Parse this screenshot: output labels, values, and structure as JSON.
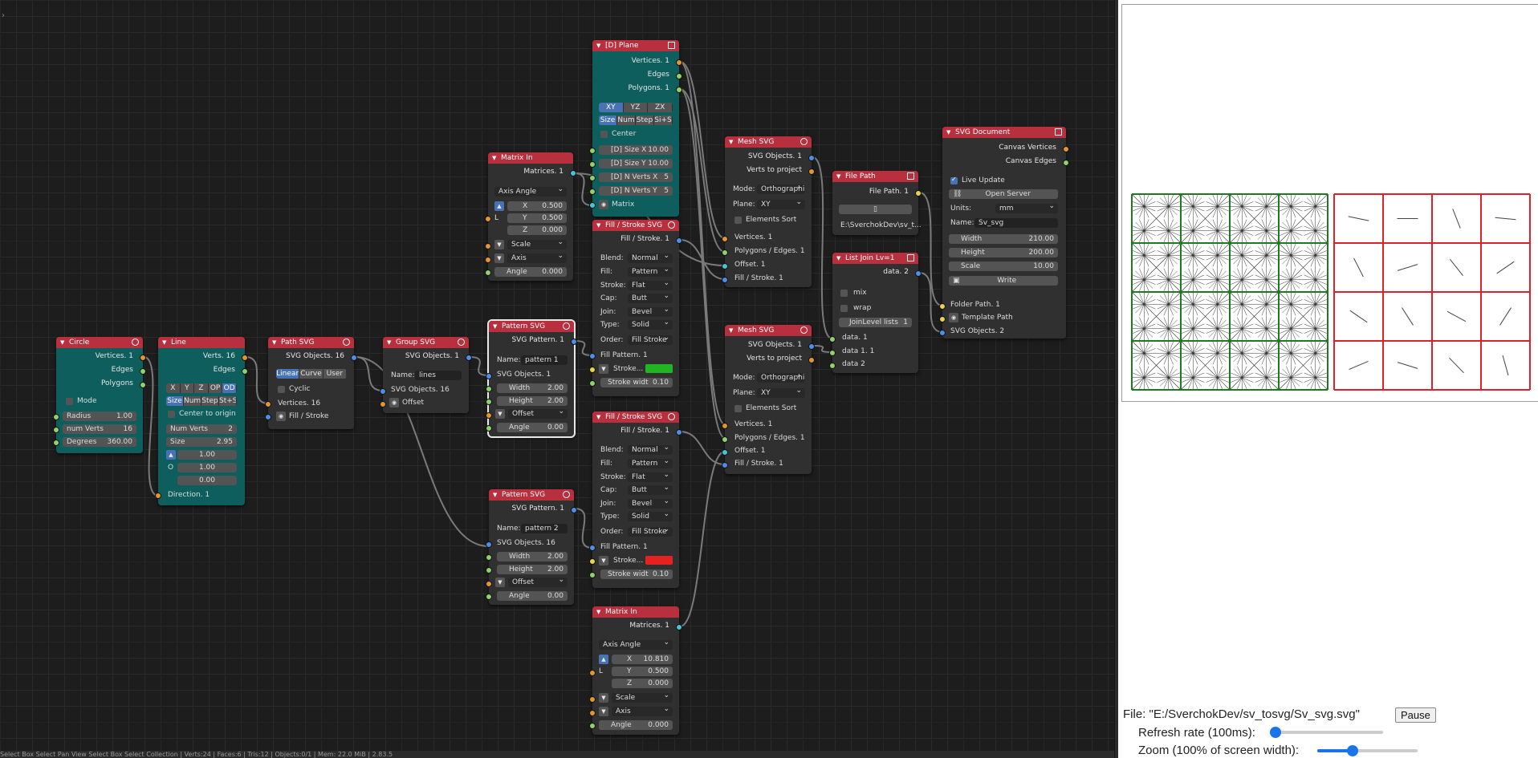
{
  "nodes": {
    "circle": {
      "title": "Circle",
      "outs": [
        "Vertices. 1",
        "Edges",
        "Polygons"
      ],
      "mode": "Mode",
      "radius_k": "Radius",
      "radius_v": "1.00",
      "numverts_k": "num Verts",
      "numverts_v": "16",
      "degrees_k": "Degrees",
      "degrees_v": "360.00"
    },
    "line": {
      "title": "Line",
      "outs": [
        "Verts. 16",
        "Edges"
      ],
      "seg": [
        "X",
        "Y",
        "Z",
        "OP",
        "OD"
      ],
      "seg2": [
        "Size",
        "Num",
        "Step",
        "St+S"
      ],
      "center": "Center to origin",
      "numverts_k": "Num Verts",
      "numverts_v": "2",
      "size_k": "Size",
      "size_v": "2.95",
      "v1": "1.00",
      "o_label": "O",
      "v2": "1.00",
      "v3": "0.00",
      "dir": "Direction. 1"
    },
    "pathsvg": {
      "title": "Path SVG",
      "out": "SVG Objects. 16",
      "seg": [
        "Linear",
        "Curve",
        "User"
      ],
      "cyclic": "Cyclic",
      "in1": "Vertices. 16",
      "in2": "Fill / Stroke"
    },
    "groupsvg": {
      "title": "Group SVG",
      "out": "SVG Objects. 1",
      "name_k": "Name:",
      "name_v": "lines",
      "in1": "SVG Objects. 16",
      "in2": "Offset"
    },
    "matrixin1": {
      "title": "Matrix In",
      "out": "Matrices. 1",
      "mode": "Axis Angle",
      "x_k": "X",
      "x_v": "0.500",
      "l": "L",
      "y_k": "Y",
      "y_v": "0.500",
      "z_k": "Z",
      "z_v": "0.000",
      "scale": "Scale",
      "axis": "Axis",
      "angle_k": "Angle",
      "angle_v": "0.000"
    },
    "pattern1": {
      "title": "Pattern SVG",
      "out": "SVG Pattern. 1",
      "name_k": "Name:",
      "name_v": "pattern 1",
      "in1": "SVG Objects. 1",
      "w_k": "Width",
      "w_v": "2.00",
      "h_k": "Height",
      "h_v": "2.00",
      "offset": "Offset",
      "a_k": "Angle",
      "a_v": "0.00"
    },
    "pattern2": {
      "title": "Pattern SVG",
      "out": "SVG Pattern. 1",
      "name_k": "Name:",
      "name_v": "pattern 2",
      "in1": "SVG Objects. 16",
      "w_k": "Width",
      "w_v": "2.00",
      "h_k": "Height",
      "h_v": "2.00",
      "offset": "Offset",
      "a_k": "Angle",
      "a_v": "0.00"
    },
    "plane": {
      "title": "[D] Plane",
      "outs": [
        "Vertices. 1",
        "Edges",
        "Polygons. 1"
      ],
      "seg": [
        "XY",
        "YZ",
        "ZX"
      ],
      "seg2": [
        "Size",
        "Num",
        "Step",
        "Si+S"
      ],
      "center": "Center",
      "sx_k": "[D] Size X",
      "sx_v": "10.00",
      "sy_k": "[D] Size Y",
      "sy_v": "10.00",
      "nx_k": "[D] N Verts X",
      "nx_v": "5",
      "ny_k": "[D] N Verts Y",
      "ny_v": "5",
      "matrix": "Matrix"
    },
    "fill1": {
      "title": "Fill / Stroke SVG",
      "out": "Fill / Stroke. 1",
      "blend_k": "Blend:",
      "blend_v": "Normal",
      "fill_k": "Fill:",
      "fill_v": "Pattern",
      "stroke_k": "Stroke:",
      "stroke_v": "Flat",
      "cap_k": "Cap:",
      "cap_v": "Butt",
      "join_k": "Join:",
      "join_v": "Bevel",
      "type_k": "Type:",
      "type_v": "Solid",
      "order_k": "Order:",
      "order_v": "Fill Stroke",
      "in1": "Fill Pattern. 1",
      "stroke_lbl": "Stroke...",
      "sw_k": "Stroke widt",
      "sw_v": "0.10",
      "color": "#22b522"
    },
    "fill2": {
      "title": "Fill / Stroke SVG",
      "out": "Fill / Stroke. 1",
      "blend_k": "Blend:",
      "blend_v": "Normal",
      "fill_k": "Fill:",
      "fill_v": "Pattern",
      "stroke_k": "Stroke:",
      "stroke_v": "Flat",
      "cap_k": "Cap:",
      "cap_v": "Butt",
      "join_k": "Join:",
      "join_v": "Bevel",
      "type_k": "Type:",
      "type_v": "Solid",
      "order_k": "Order:",
      "order_v": "Fill Stroke",
      "in1": "Fill Pattern. 1",
      "stroke_lbl": "Stroke...",
      "sw_k": "Stroke widt",
      "sw_v": "0.10",
      "color": "#e52222"
    },
    "matrixin2": {
      "title": "Matrix In",
      "out": "Matrices. 1",
      "mode": "Axis Angle",
      "x_k": "X",
      "x_v": "10.810",
      "l": "L",
      "y_k": "Y",
      "y_v": "0.500",
      "z_k": "Z",
      "z_v": "0.000",
      "scale": "Scale",
      "axis": "Axis",
      "angle_k": "Angle",
      "angle_v": "0.000"
    },
    "mesh1": {
      "title": "Mesh SVG",
      "outs": [
        "SVG Objects. 1",
        "Verts to project"
      ],
      "mode_k": "Mode:",
      "mode_v": "Orthographic",
      "plane_k": "Plane:",
      "plane_v": "XY",
      "sort": "Elements Sort",
      "ins": [
        "Vertices. 1",
        "Polygons / Edges. 1",
        "Offset. 1",
        "Fill / Stroke. 1"
      ]
    },
    "mesh2": {
      "title": "Mesh SVG",
      "outs": [
        "SVG Objects. 1",
        "Verts to project"
      ],
      "mode_k": "Mode:",
      "mode_v": "Orthographic",
      "plane_k": "Plane:",
      "plane_v": "XY",
      "sort": "Elements Sort",
      "ins": [
        "Vertices. 1",
        "Polygons / Edges. 1",
        "Offset. 1",
        "Fill / Stroke. 1"
      ]
    },
    "filepath": {
      "title": "File Path",
      "out": "File Path. 1",
      "path": "E:\\SverchokDev\\sv_t..."
    },
    "listjoin": {
      "title": "List Join Lv=1",
      "out": "data. 2",
      "mix": "mix",
      "wrap": "wrap",
      "jl_k": "JoinLevel lists",
      "jl_v": "1",
      "ins": [
        "data. 1",
        "data 1. 1",
        "data 2"
      ]
    },
    "svgdoc": {
      "title": "SVG Document",
      "outs": [
        "Canvas Vertices",
        "Canvas Edges"
      ],
      "live": "Live Update",
      "server": "Open Server",
      "units_k": "Units:",
      "units_v": "mm",
      "name_k": "Name:",
      "name_v": "Sv_svg",
      "w_k": "Width",
      "w_v": "210.00",
      "h_k": "Height",
      "h_v": "200.00",
      "s_k": "Scale",
      "s_v": "10.00",
      "write": "Write",
      "ins": [
        "Folder Path. 1",
        "Template Path",
        "SVG Objects. 2"
      ]
    }
  },
  "preview": {
    "file_text": "File: \"E:/SverchokDev/sv_tosvg/Sv_svg.svg\"",
    "pause": "Pause",
    "refresh": "Refresh rate (100ms):",
    "refresh_value": 0.03,
    "zoom": "Zoom (100% of screen width):",
    "zoom_value": 0.35,
    "green_color": "#1e7a1e",
    "red_color": "#e0202a"
  },
  "statusbar": "Select     Box Select          Pan View                  Select     Box Select                                                                                                                                      Collection | Verts:24 | Faces:6 | Tris:12 | Objects:0/1 | Mem: 22.0 MiB | 2.83.5"
}
